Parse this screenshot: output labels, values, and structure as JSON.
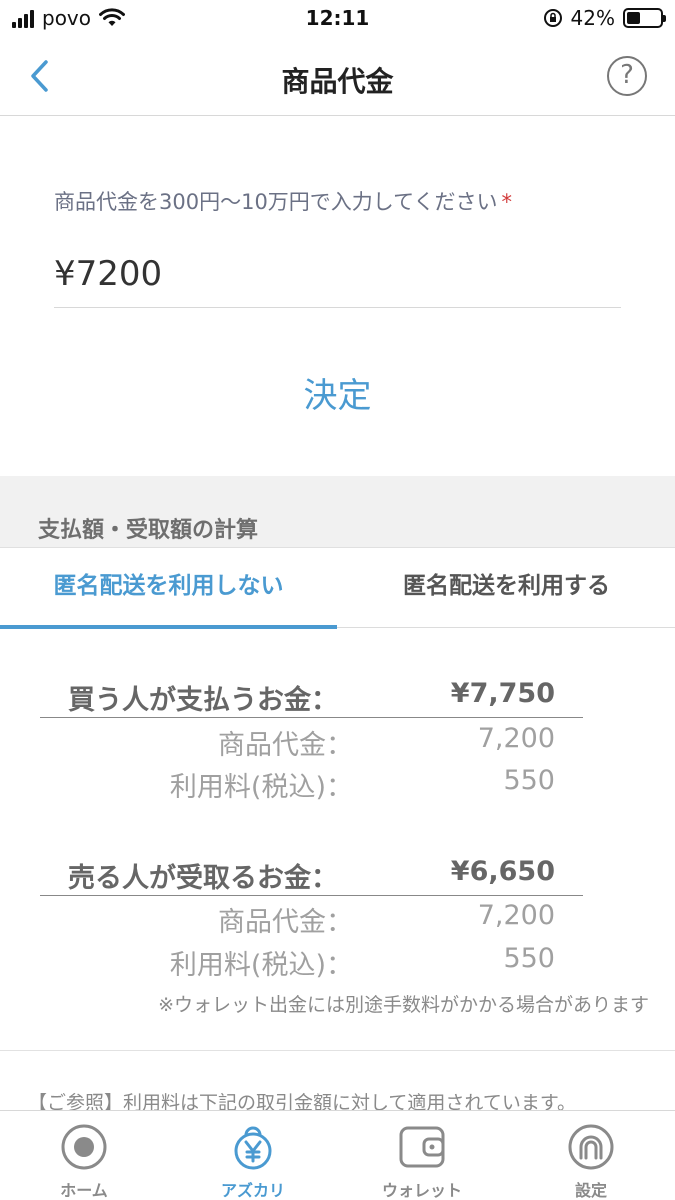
{
  "status_bar": {
    "carrier": "povo",
    "time": "12:11",
    "battery": "42%"
  },
  "nav": {
    "title": "商品代金"
  },
  "form": {
    "label": "商品代金を300円〜10万円で入力してください",
    "required_mark": "*",
    "value": "¥7200",
    "submit_label": "決定"
  },
  "calc": {
    "section_title": "支払額・受取額の計算",
    "tabs": [
      {
        "label": "匿名配送を利用しない",
        "active": true
      },
      {
        "label": "匿名配送を利用する",
        "active": false
      }
    ],
    "buyer": {
      "label": "買う人が支払うお金：",
      "total": "¥7,750",
      "rows": [
        {
          "label": "商品代金：",
          "value": "7,200"
        },
        {
          "label": "利用料(税込)：",
          "value": "550"
        }
      ]
    },
    "seller": {
      "label": "売る人が受取るお金：",
      "total": "¥6,650",
      "rows": [
        {
          "label": "商品代金：",
          "value": "7,200"
        },
        {
          "label": "利用料(税込)：",
          "value": "550"
        }
      ]
    },
    "note": "※ウォレット出金には別途手数料がかかる場合があります",
    "reference": "【ご参照】利用料は下記の取引金額に対して適用されています。"
  },
  "tab_bar": {
    "items": [
      {
        "label": "ホーム",
        "icon": "home-icon"
      },
      {
        "label": "アズカリ",
        "icon": "azukari-icon",
        "active": true
      },
      {
        "label": "ウォレット",
        "icon": "wallet-icon"
      },
      {
        "label": "設定",
        "icon": "settings-icon"
      }
    ]
  },
  "colors": {
    "accent": "#4a9ad1",
    "required": "#d23b3b",
    "inactive_tab": "#8a8a8a"
  }
}
